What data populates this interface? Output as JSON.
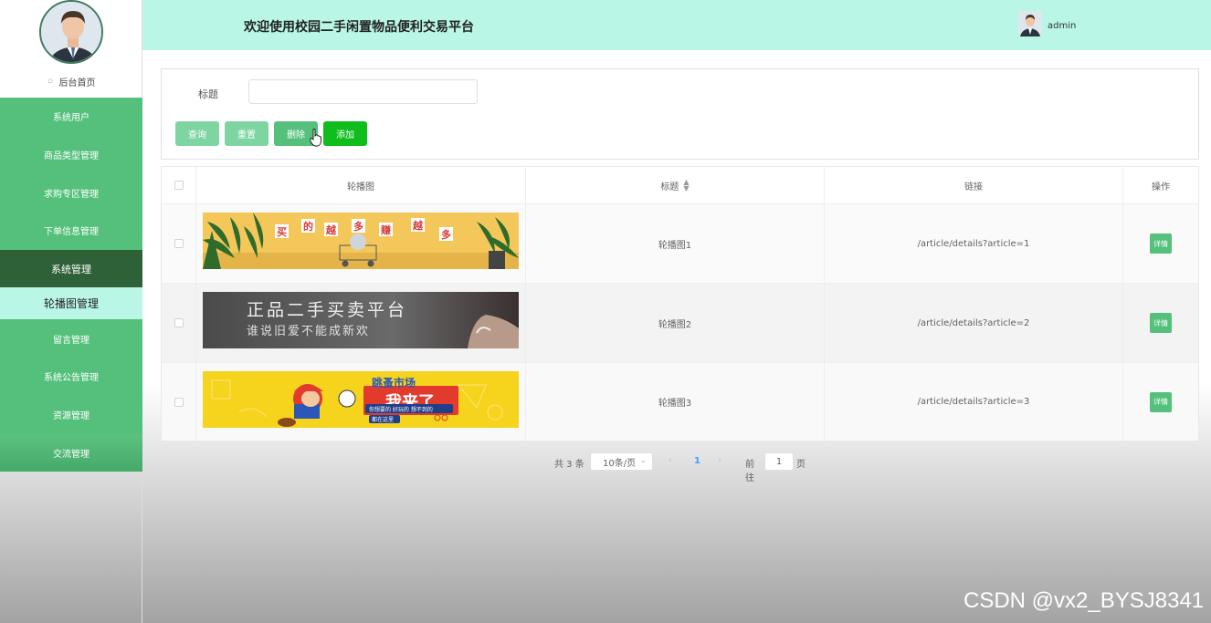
{
  "sidebar": {
    "home_label": "后台首页",
    "items": [
      {
        "label": "系统用户"
      },
      {
        "label": "商品类型管理"
      },
      {
        "label": "求购专区管理"
      },
      {
        "label": "下单信息管理"
      },
      {
        "label": "系统管理"
      },
      {
        "label": "轮播图管理"
      },
      {
        "label": "留言管理"
      },
      {
        "label": "系统公告管理"
      },
      {
        "label": "资源管理"
      },
      {
        "label": "交流管理"
      }
    ]
  },
  "header": {
    "title": "欢迎使用校园二手闲置物品便利交易平台",
    "username": "admin"
  },
  "search": {
    "label": "标题",
    "value": "",
    "buttons": {
      "search": "查询",
      "reset": "重置",
      "delete": "删除",
      "add": "添加"
    }
  },
  "table": {
    "headers": {
      "image": "轮播图",
      "title": "标题",
      "link": "链接",
      "action": "操作"
    },
    "rows": [
      {
        "title": "轮播图1",
        "link": "/article/details?article=1",
        "action": "详情",
        "banner_chars": [
          "买",
          "的",
          "越",
          "多",
          "赚",
          "越",
          "多"
        ]
      },
      {
        "title": "轮播图2",
        "link": "/article/details?article=2",
        "action": "详情",
        "banner_main": "正品二手买卖平台",
        "banner_sub": "谁说旧爱不能成新欢"
      },
      {
        "title": "轮播图3",
        "link": "/article/details?article=3",
        "action": "详情",
        "banner_main": "我来了",
        "banner_top": "跳蚤市场",
        "banner_sub": "你想要的 好玩的 想不到的",
        "banner_tag": "都在这里"
      }
    ]
  },
  "pagination": {
    "total": "共 3 条",
    "page_size": "10条/页",
    "current": "1",
    "goto": "前往",
    "goto_value": "1",
    "page_suffix": "页"
  },
  "watermark": "CSDN @vx2_BYSJ8341",
  "colors": {
    "menu": "#55c07c",
    "menu_active": "#2f6139",
    "header": "#b9f6e5",
    "add_button": "#0fbd1c"
  }
}
